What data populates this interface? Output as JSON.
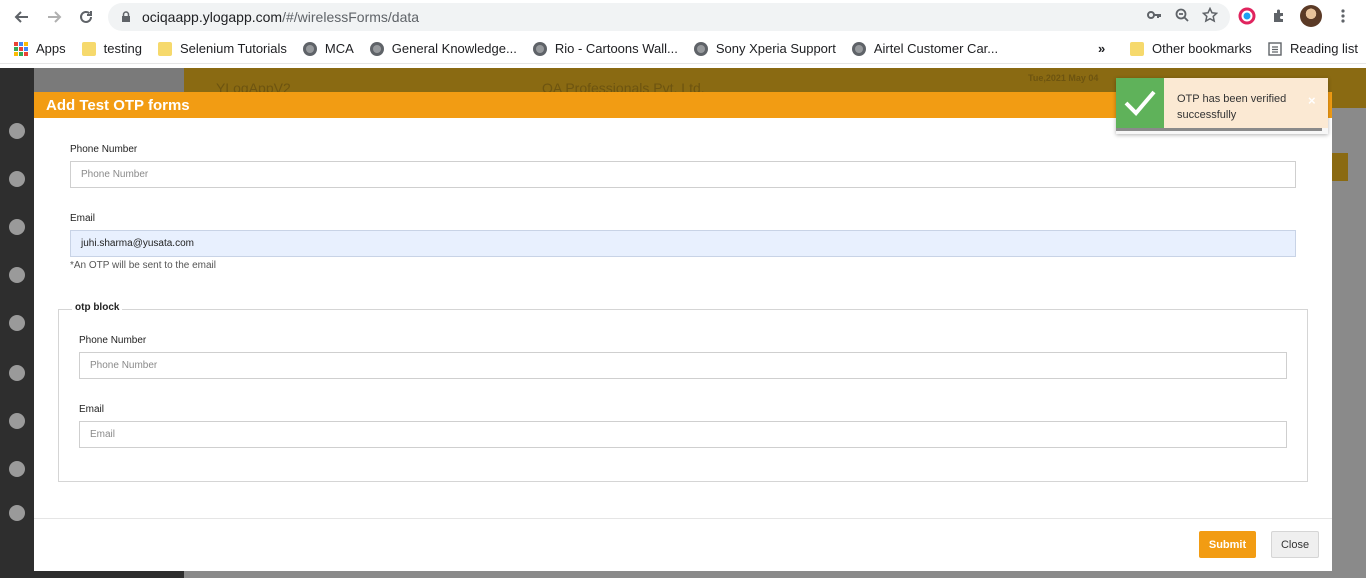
{
  "browser": {
    "url_host": "ociqaapp.ylogapp.com",
    "url_path": "/#/wirelessForms/data",
    "bookmarks": [
      {
        "label": "Apps",
        "icon": "apps-grid-icon"
      },
      {
        "label": "testing",
        "icon": "folder-icon"
      },
      {
        "label": "Selenium Tutorials",
        "icon": "folder-icon"
      },
      {
        "label": "MCA",
        "icon": "globe-icon"
      },
      {
        "label": "General Knowledge...",
        "icon": "globe-icon"
      },
      {
        "label": "Rio - Cartoons Wall...",
        "icon": "globe-icon"
      },
      {
        "label": "Sony Xperia Support",
        "icon": "globe-icon"
      },
      {
        "label": "Airtel Customer Car...",
        "icon": "globe-icon"
      }
    ],
    "more_bookmarks": "»",
    "other_bookmarks": "Other bookmarks",
    "reading_list": "Reading list"
  },
  "background_app": {
    "title": "YLogAppV2",
    "company": "QA Professionals Pvt. Ltd.",
    "date": "Tue,2021 May 04"
  },
  "modal": {
    "title": "Add Test OTP forms",
    "phone_label": "Phone Number",
    "phone_placeholder": "Phone Number",
    "email_label": "Email",
    "email_value": "juhi.sharma@yusata.com",
    "email_hint": "*An OTP will be sent to the email",
    "otp_block": {
      "legend": "otp block",
      "phone_label": "Phone Number",
      "phone_placeholder": "Phone Number",
      "email_label": "Email",
      "email_placeholder": "Email"
    },
    "submit_label": "Submit",
    "close_label": "Close"
  },
  "toast": {
    "message": "OTP has been verified successfully",
    "close_glyph": "×",
    "success_color": "#5fb25a"
  },
  "colors": {
    "accent": "#f29c13"
  }
}
